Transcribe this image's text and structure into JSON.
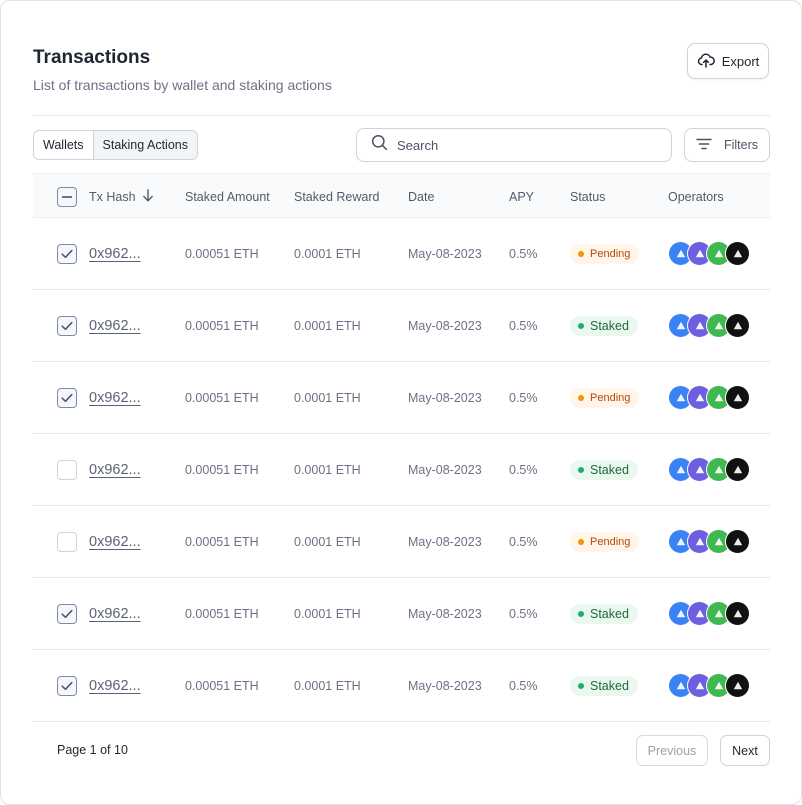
{
  "header": {
    "title": "Transactions",
    "subtitle": "List of transactions by wallet and staking actions",
    "export_label": "Export",
    "export_icon": "cloud-upload-icon"
  },
  "toolbar": {
    "tabs": [
      {
        "label": "Wallets",
        "active": false
      },
      {
        "label": "Staking Actions",
        "active": true
      }
    ],
    "search_placeholder": "Search",
    "filters_label": "Filters"
  },
  "table": {
    "columns": [
      "Tx Hash",
      "Staked Amount",
      "Staked Reward",
      "Date",
      "APY",
      "Status",
      "Operators"
    ],
    "sort_icon": "arrow-down-icon",
    "operator_colors": [
      "#3b82f6",
      "#6d5fe0",
      "#3fb950",
      "#111111"
    ],
    "status_colors": {
      "Pending": "#f79009",
      "Staked": "#17b26a"
    },
    "rows": [
      {
        "checked": true,
        "hash": "0x962...",
        "amount": "0.00051 ETH",
        "reward": "0.0001 ETH",
        "date": "May-08-2023",
        "apy": "0.5%",
        "status": "Pending"
      },
      {
        "checked": true,
        "hash": "0x962...",
        "amount": "0.00051 ETH",
        "reward": "0.0001 ETH",
        "date": "May-08-2023",
        "apy": "0.5%",
        "status": "Staked"
      },
      {
        "checked": true,
        "hash": "0x962...",
        "amount": "0.00051 ETH",
        "reward": "0.0001 ETH",
        "date": "May-08-2023",
        "apy": "0.5%",
        "status": "Pending"
      },
      {
        "checked": false,
        "hash": "0x962...",
        "amount": "0.00051 ETH",
        "reward": "0.0001 ETH",
        "date": "May-08-2023",
        "apy": "0.5%",
        "status": "Staked"
      },
      {
        "checked": false,
        "hash": "0x962...",
        "amount": "0.00051 ETH",
        "reward": "0.0001 ETH",
        "date": "May-08-2023",
        "apy": "0.5%",
        "status": "Pending"
      },
      {
        "checked": true,
        "hash": "0x962...",
        "amount": "0.00051 ETH",
        "reward": "0.0001 ETH",
        "date": "May-08-2023",
        "apy": "0.5%",
        "status": "Staked"
      },
      {
        "checked": true,
        "hash": "0x962...",
        "amount": "0.00051 ETH",
        "reward": "0.0001 ETH",
        "date": "May-08-2023",
        "apy": "0.5%",
        "status": "Staked"
      }
    ]
  },
  "pagination": {
    "page_text": "Page 1 of 10",
    "previous_label": "Previous",
    "next_label": "Next"
  }
}
